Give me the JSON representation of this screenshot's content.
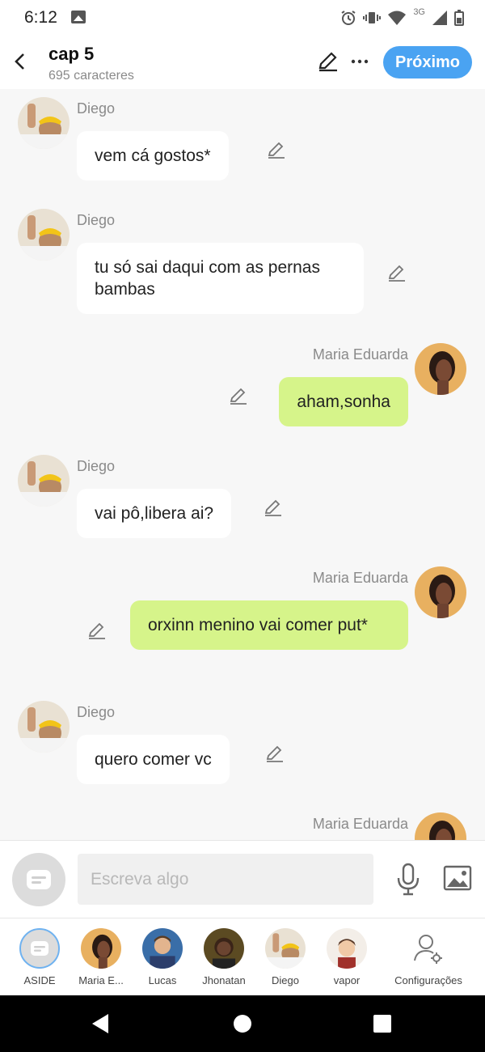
{
  "status_bar": {
    "time": "6:12",
    "network_label": "3G"
  },
  "header": {
    "title": "cap 5",
    "subtitle": "695 caracteres",
    "next_label": "Próximo"
  },
  "messages": [
    {
      "sender": "Diego",
      "text": "vem cá gostos*",
      "side": "left"
    },
    {
      "sender": "Diego",
      "text": "tu só sai daqui com as pernas bambas",
      "side": "left"
    },
    {
      "sender": "Maria Eduarda",
      "text": "aham,sonha",
      "side": "right"
    },
    {
      "sender": "Diego",
      "text": "vai pô,libera ai?",
      "side": "left"
    },
    {
      "sender": "Maria Eduarda",
      "text": "orxinn menino vai comer put*",
      "side": "right"
    },
    {
      "sender": "Diego",
      "text": "quero comer vc",
      "side": "left"
    },
    {
      "sender": "Maria Eduarda",
      "text": "",
      "side": "right"
    }
  ],
  "input": {
    "placeholder": "Escreva algo"
  },
  "characters": [
    {
      "label": "ASIDE",
      "icon": "aside-icon"
    },
    {
      "label": "Maria E...",
      "icon": "avatar"
    },
    {
      "label": "Lucas",
      "icon": "avatar"
    },
    {
      "label": "Jhonatan",
      "icon": "avatar"
    },
    {
      "label": "Diego",
      "icon": "avatar"
    },
    {
      "label": "vapor",
      "icon": "avatar"
    },
    {
      "label": "Configurações",
      "icon": "settings-user-icon"
    }
  ],
  "colors": {
    "accent": "#4aa3f2",
    "right_bubble": "#d6f48a",
    "left_bubble": "#ffffff"
  }
}
